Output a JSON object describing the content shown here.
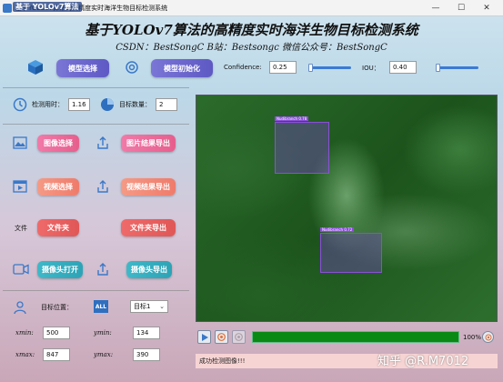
{
  "window": {
    "title": "基于YOLOv7算法的高精度实时海洋生物目标检测系统",
    "watermark_badge": "基于 YOLOv7算法",
    "minimize": "—",
    "maximize": "☐",
    "close": "✕"
  },
  "header": {
    "title": "基于YOLOv7算法的高精度实时海洋生物目标检测系统",
    "subtitle": "CSDN：BestSongC   B站：Bestsongc   微信公众号：BestSongC"
  },
  "toolbar": {
    "model_select": "模型选择",
    "model_init": "模型初始化",
    "confidence_label": "Confidence:",
    "confidence_value": "0.25",
    "confidence_level": 0.25,
    "iou_label": "IOU：",
    "iou_value": "0.40",
    "iou_level": 0.4
  },
  "stats": {
    "time_label": "检测用时：",
    "time_value": "1.16",
    "count_label": "目标数量：",
    "count_value": "2"
  },
  "actions": {
    "image_select": "图像选择",
    "image_export": "图片结果导出",
    "video_select": "视频选择",
    "video_export": "视频结果导出",
    "folder_label": "文件",
    "folder_select": "文件夹",
    "folder_export": "文件夹导出",
    "camera_open": "摄像头打开",
    "camera_export": "摄像头导出"
  },
  "target": {
    "position_label": "目标位置：",
    "all_icon_text": "ALL",
    "selected": "目标1",
    "xmin_label": "xmin:",
    "xmin_value": "500",
    "ymin_label": "ymin:",
    "ymin_value": "134",
    "xmax_label": "xmax:",
    "xmax_value": "847",
    "ymax_label": "ymax:",
    "ymax_value": "390"
  },
  "detections": [
    {
      "label": "Nudibranch 0.78"
    },
    {
      "label": "Nudibranch 0.72"
    }
  ],
  "player": {
    "progress": 1.0,
    "progress_text": "100%"
  },
  "status": {
    "message": "成功检测图像!!!"
  },
  "footer_watermark": "知乎 @R.M7012",
  "colors": {
    "accent_blue": "#5e59c4",
    "progress_green": "#0a8a14",
    "status_bg": "#f7d4d4",
    "bbox_purple": "#8a4fd8"
  }
}
